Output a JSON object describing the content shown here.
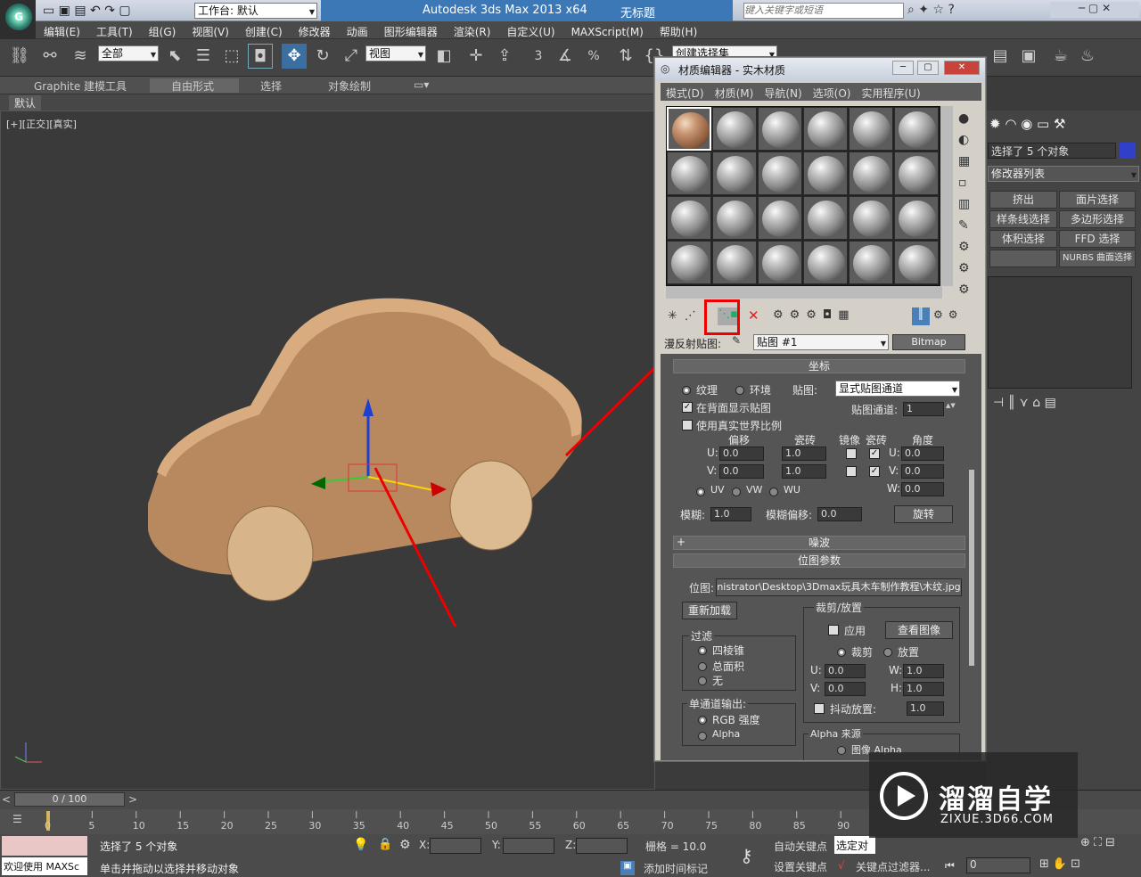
{
  "app": {
    "title": "Autodesk 3ds Max  2013 x64",
    "doc": "无标题",
    "workspace": "工作台: 默认",
    "search_placeholder": "键入关键字或短语"
  },
  "menu": [
    "编辑(E)",
    "工具(T)",
    "组(G)",
    "视图(V)",
    "创建(C)",
    "修改器",
    "动画",
    "图形编辑器",
    "渲染(R)",
    "自定义(U)",
    "MAXScript(M)",
    "帮助(H)"
  ],
  "toolbar": {
    "selection_filter": "全部",
    "ref_coord": "视图",
    "named_selection": "创建选择集",
    "snap_3": "3",
    "snap_pct": "%"
  },
  "ribbon": {
    "tabs": [
      "Graphite 建模工具",
      "自由形式",
      "选择",
      "对象绘制"
    ],
    "sub": "默认"
  },
  "viewport": {
    "label": "[+][正交][真实]"
  },
  "material_editor": {
    "title": "材质编辑器 - 实木材质",
    "menu": [
      "模式(D)",
      "材质(M)",
      "导航(N)",
      "选项(O)",
      "实用程序(U)"
    ],
    "map_label": "漫反射贴图:",
    "map_name": "贴图 #1",
    "map_type": "Bitmap",
    "coords": {
      "header": "坐标",
      "texture": "纹理",
      "environ": "环境",
      "mapping_label": "贴图:",
      "mapping_value": "显式贴图通道",
      "show_back": "在背面显示贴图",
      "map_channel_label": "贴图通道:",
      "map_channel": "1",
      "real_world": "使用真实世界比例",
      "col_offset": "偏移",
      "col_tiling": "瓷砖",
      "col_mirror": "镜像",
      "col_tile": "瓷砖",
      "col_angle": "角度",
      "u_off": "0.0",
      "v_off": "0.0",
      "u_tile": "1.0",
      "v_tile": "1.0",
      "u_ang": "0.0",
      "v_ang": "0.0",
      "w_ang": "0.0",
      "uv": "UV",
      "vw": "VW",
      "wu": "WU",
      "blur_label": "模糊:",
      "blur": "1.0",
      "blur_off_label": "模糊偏移:",
      "blur_off": "0.0",
      "rotate": "旋转"
    },
    "noise": {
      "header": "噪波"
    },
    "bitmap_params": {
      "header": "位图参数",
      "bitmap_label": "位图:",
      "bitmap_path": "nistrator\\Desktop\\3Dmax玩具木车制作教程\\木纹.jpg",
      "reload": "重新加载",
      "crop_group": "裁剪/放置",
      "apply": "应用",
      "view_image": "查看图像",
      "crop": "裁剪",
      "place": "放置",
      "u": "0.0",
      "v": "0.0",
      "w": "1.0",
      "h": "1.0",
      "jitter": "抖动放置:",
      "jitter_val": "1.0",
      "filter_group": "过滤",
      "f1": "四棱锥",
      "f2": "总面积",
      "f3": "无",
      "mono_group": "单通道输出:",
      "m1": "RGB 强度",
      "m2": "Alpha",
      "alpha_group": "Alpha 来源",
      "a1": "图像 Alpha"
    }
  },
  "cmdpanel": {
    "selected": "选择了 5 个对象",
    "modlist": "修改器列表",
    "buttons": [
      "挤出",
      "面片选择",
      "样条线选择",
      "多边形选择",
      "体积选择",
      "FFD 选择",
      "",
      "NURBS 曲面选择"
    ]
  },
  "timeline": {
    "frame": "0 / 100",
    "ticks": [
      "0",
      "5",
      "10",
      "15",
      "20",
      "25",
      "30",
      "35",
      "40",
      "45",
      "50",
      "55",
      "60",
      "65",
      "70",
      "75",
      "80",
      "85",
      "90"
    ]
  },
  "status": {
    "welcome": "欢迎使用 MAXSc",
    "selected": "选择了 5 个对象",
    "prompt": "单击并拖动以选择并移动对象",
    "x": "X:",
    "y": "Y:",
    "z": "Z:",
    "grid": "栅格 = 10.0",
    "auto_key": "自动关键点",
    "set_key": "设置关键点",
    "sel_obj": "选定对",
    "key_filter": "关键点过滤器...",
    "add_time": "添加时间标记",
    "frame": "0"
  },
  "watermark": {
    "brand": "溜溜自学",
    "url": "ZIXUE.3D66.COM"
  }
}
